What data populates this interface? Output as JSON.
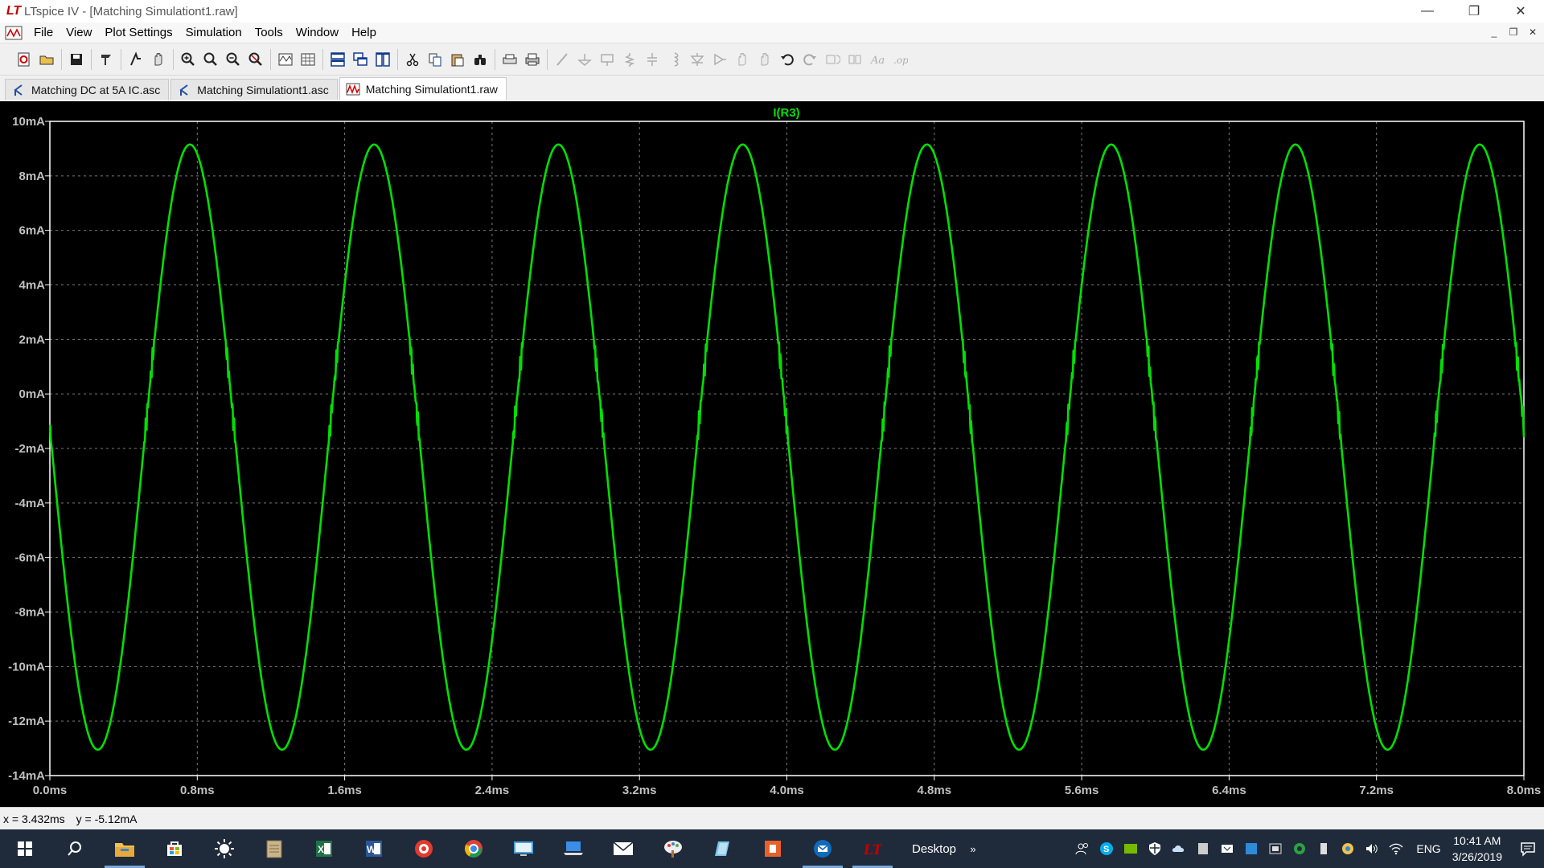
{
  "window": {
    "title": "LTspice IV - [Matching Simulationt1.raw]",
    "minimize_glyph": "—",
    "restore_glyph": "❐",
    "close_glyph": "✕"
  },
  "menu": {
    "items": [
      "File",
      "View",
      "Plot Settings",
      "Simulation",
      "Tools",
      "Window",
      "Help"
    ],
    "mdi_min": "_",
    "mdi_restore": "❐",
    "mdi_close": "✕"
  },
  "toolbar": {
    "icons": [
      "new-schematic-icon",
      "open-icon",
      "save-icon",
      "control-panel-icon",
      "run-icon",
      "halt-icon",
      "zoom-in-icon",
      "zoom-area-icon",
      "zoom-out-icon",
      "zoom-fit-icon",
      "autorange-icon",
      "grid-icon",
      "tile-horizontal-icon",
      "cascade-icon",
      "tile-vertical-icon",
      "cut-icon",
      "copy-icon",
      "paste-icon",
      "find-icon",
      "print-setup-icon",
      "print-icon",
      "wire-icon",
      "ground-icon",
      "label-icon",
      "resistor-icon",
      "capacitor-icon",
      "inductor-icon",
      "diode-icon",
      "component-icon",
      "move-icon",
      "drag-icon",
      "undo-icon",
      "redo-icon",
      "rotate-icon",
      "mirror-icon",
      "text-icon",
      "spice-directive-icon"
    ]
  },
  "tabs": [
    {
      "label": "Matching DC at 5A IC.asc",
      "icon": "schematic-icon",
      "active": false
    },
    {
      "label": "Matching Simulationt1.asc",
      "icon": "schematic-icon",
      "active": false
    },
    {
      "label": "Matching Simulationt1.raw",
      "icon": "waveform-icon",
      "active": true
    }
  ],
  "colors": {
    "trace": "#00e000",
    "grid": "#7a7a7a",
    "axis_text": "#c0c0c0",
    "plot_bg": "#000000",
    "frame": "#ffffff"
  },
  "chart_data": {
    "type": "line",
    "title": "I(R3)",
    "xlabel": "",
    "ylabel": "",
    "xlim": [
      0.0,
      8.0
    ],
    "ylim": [
      -14,
      10
    ],
    "x_unit": "ms",
    "y_unit": "mA",
    "x_tick_values": [
      0.0,
      0.8,
      1.6,
      2.4,
      3.2,
      4.0,
      4.8,
      5.6,
      6.4,
      7.2,
      8.0
    ],
    "x_tick_labels": [
      "0.0ms",
      "0.8ms",
      "1.6ms",
      "2.4ms",
      "3.2ms",
      "4.0ms",
      "4.8ms",
      "5.6ms",
      "6.4ms",
      "7.2ms",
      "8.0ms"
    ],
    "y_tick_values": [
      10,
      8,
      6,
      4,
      2,
      0,
      -2,
      -4,
      -6,
      -8,
      -10,
      -12,
      -14
    ],
    "y_tick_labels": [
      "10mA",
      "8mA",
      "6mA",
      "4mA",
      "2mA",
      "0mA",
      "-2mA",
      "-4mA",
      "-6mA",
      "-8mA",
      "-10mA",
      "-12mA",
      "-14mA"
    ],
    "grid": true,
    "legend": "none",
    "series": [
      {
        "name": "I(R3)",
        "frequency_hz": 1000,
        "offset_ma": -1.95,
        "amplitude_ma": 11.1,
        "peak_ma": 9.15,
        "trough_ma": -13.05,
        "first_peak_ms": 0.76,
        "glitch_levels_ma": [
          1.2,
          -1.0
        ]
      }
    ]
  },
  "status": {
    "x_readout": "x = 3.432ms",
    "y_readout": "y = -5.12mA"
  },
  "taskbar": {
    "apps": [
      "file-explorer-icon",
      "store-icon",
      "brightness-icon",
      "notepad-icon",
      "excel-icon",
      "word-icon",
      "media-icon",
      "chrome-icon",
      "remote-desktop-icon",
      "laptop-icon",
      "mail-icon",
      "paint-icon",
      "documents-icon",
      "office-icon",
      "outlook-icon",
      "ltspice-icon"
    ],
    "desktop_label": "Desktop",
    "overflow_glyph": "»",
    "tray_icons": [
      "people-icon",
      "skype-icon",
      "nvidia-icon",
      "defender-icon",
      "onedrive-icon",
      "tablet-icon",
      "cloud-icon",
      "vpn-icon",
      "network-drive-icon",
      "monitor-icon",
      "update-icon",
      "usb-icon",
      "sync-icon",
      "volume-icon",
      "wifi-icon"
    ],
    "language": "ENG",
    "time": "10:41 AM",
    "date": "3/26/2019"
  }
}
